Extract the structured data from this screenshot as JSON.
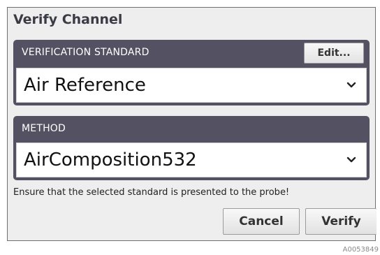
{
  "dialog": {
    "title": "Verify Channel",
    "notice": "Ensure that the selected standard is presented to the probe!",
    "cancel_label": "Cancel",
    "verify_label": "Verify"
  },
  "verification_standard": {
    "label": "VERIFICATION STANDARD",
    "edit_label": "Edit...",
    "selected": "Air Reference"
  },
  "method": {
    "label": "METHOD",
    "selected": "AirComposition532"
  },
  "figure_id": "A0053849",
  "colors": {
    "panel_bg": "#545262",
    "dialog_bg": "#eeeeee",
    "title_text": "#3b3b46"
  },
  "icons": {
    "dropdown": "chevron-down-icon"
  }
}
